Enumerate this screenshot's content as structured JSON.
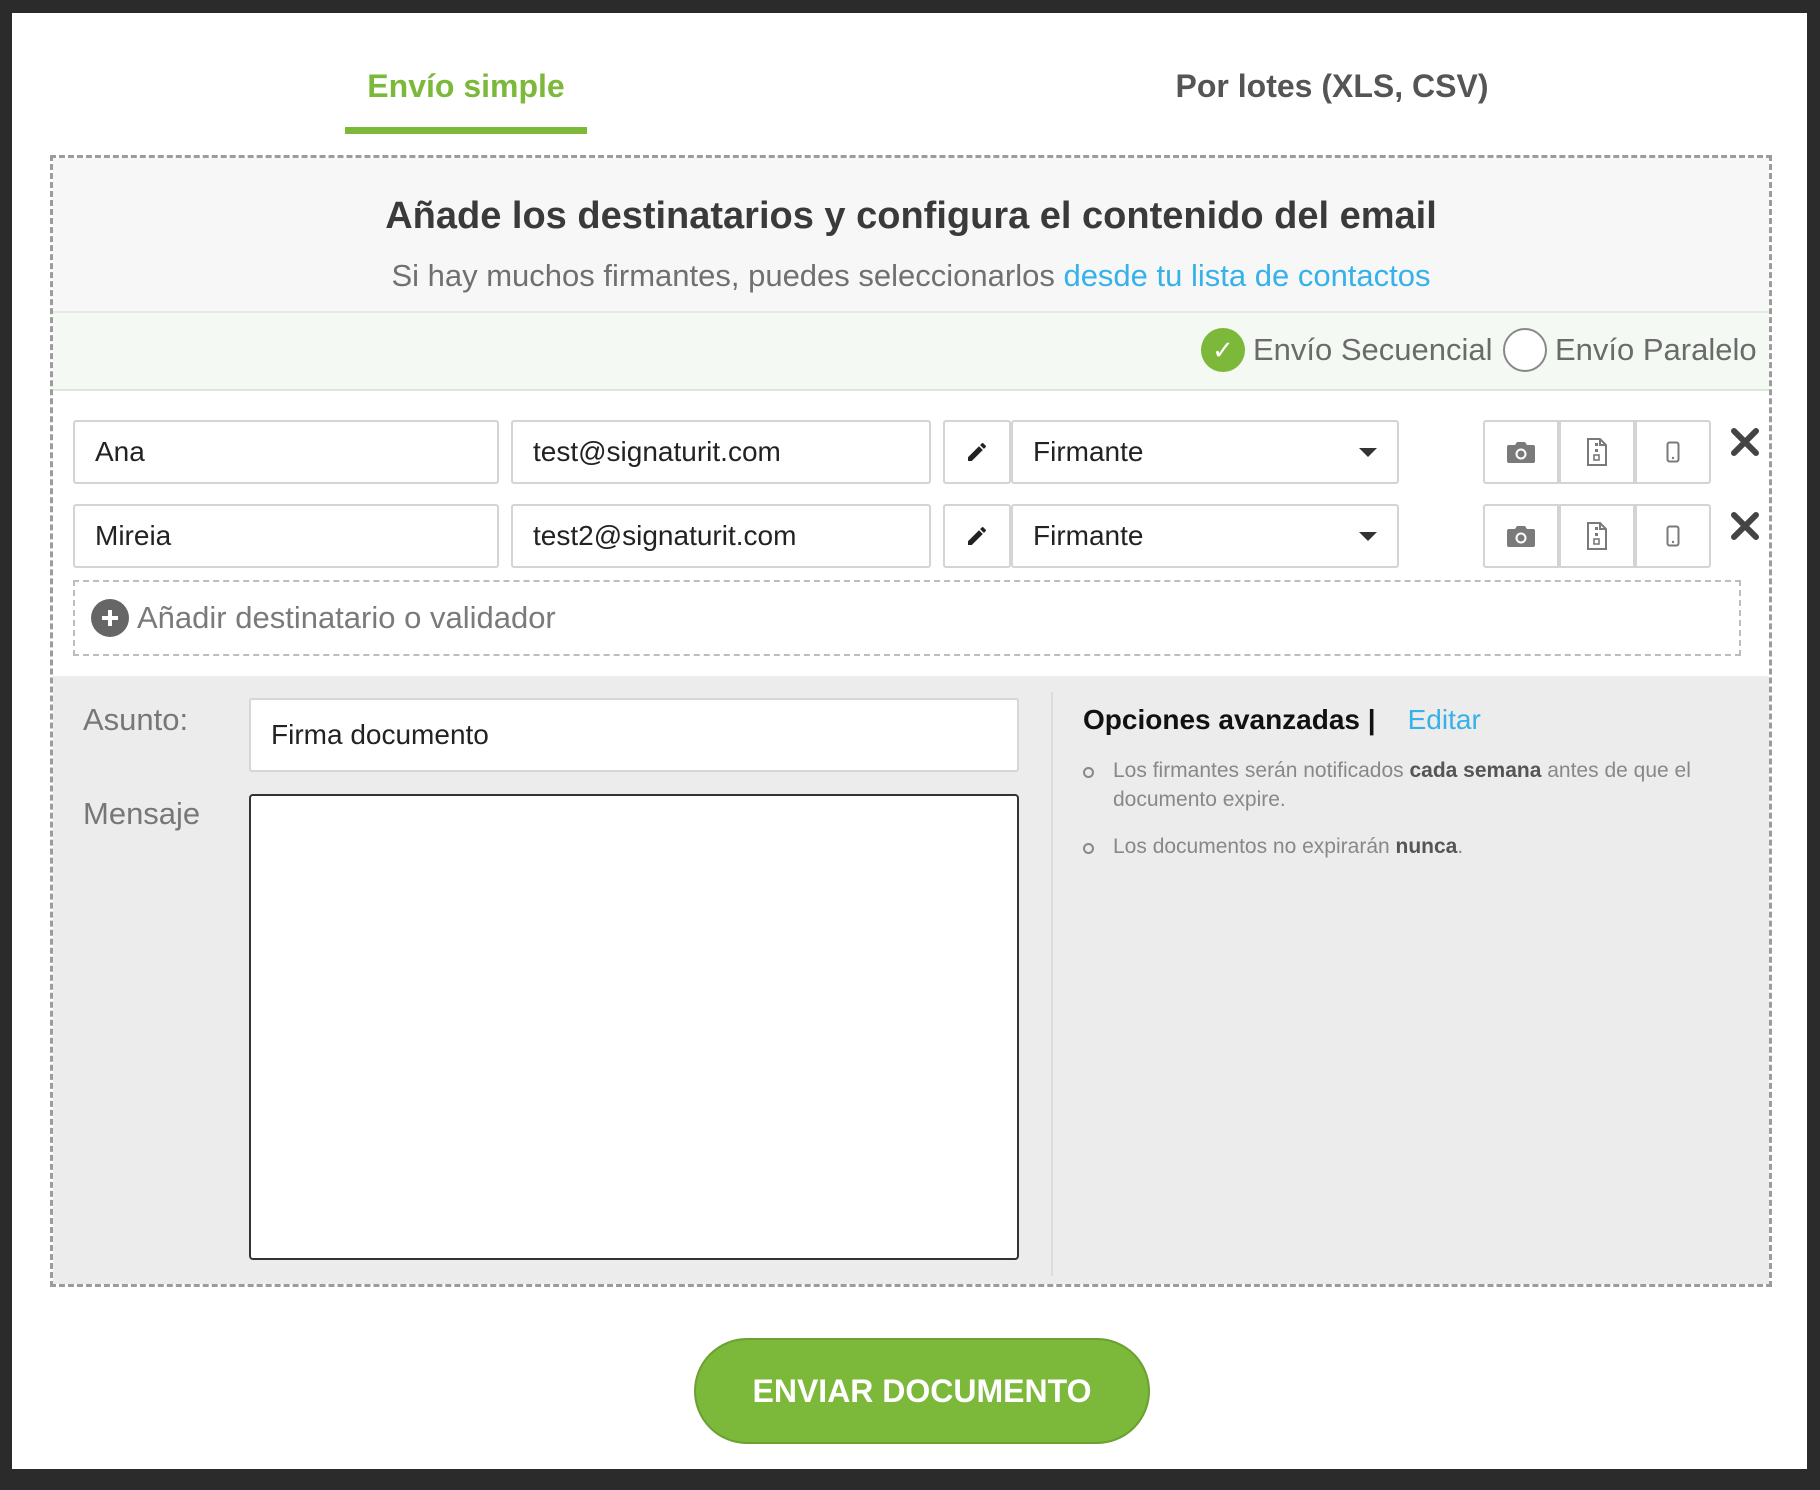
{
  "tabs": {
    "simple": "Envío simple",
    "batch": "Por lotes (XLS, CSV)"
  },
  "header": {
    "title": "Añade los destinatarios y configura el contenido del email",
    "subtitle_prefix": "Si hay muchos firmantes, puedes seleccionarlos ",
    "subtitle_link": "desde tu lista de contactos"
  },
  "send_modes": {
    "sequential": "Envío Secuencial",
    "parallel": "Envío Paralelo",
    "selected": "sequential"
  },
  "recipients": [
    {
      "name": "Ana",
      "email": "test@signaturit.com",
      "role": "Firmante"
    },
    {
      "name": "Mireia",
      "email": "test2@signaturit.com",
      "role": "Firmante"
    }
  ],
  "add_recipient_label": "Añadir destinatario o validador",
  "form": {
    "subject_label": "Asunto:",
    "subject_value": "Firma documento",
    "message_label": "Mensaje",
    "message_value": ""
  },
  "advanced": {
    "title": "Opciones avanzadas |",
    "edit_label": "Editar",
    "item1_pre": "Los firmantes serán notificados ",
    "item1_bold": "cada semana",
    "item1_post": " antes de que el documento expire.",
    "item2_pre": "Los documentos no expirarán ",
    "item2_bold": "nunca",
    "item2_post": "."
  },
  "send_button": "ENVIAR DOCUMENTO",
  "colors": {
    "accent": "#7cb83a",
    "link": "#36b1ea"
  }
}
